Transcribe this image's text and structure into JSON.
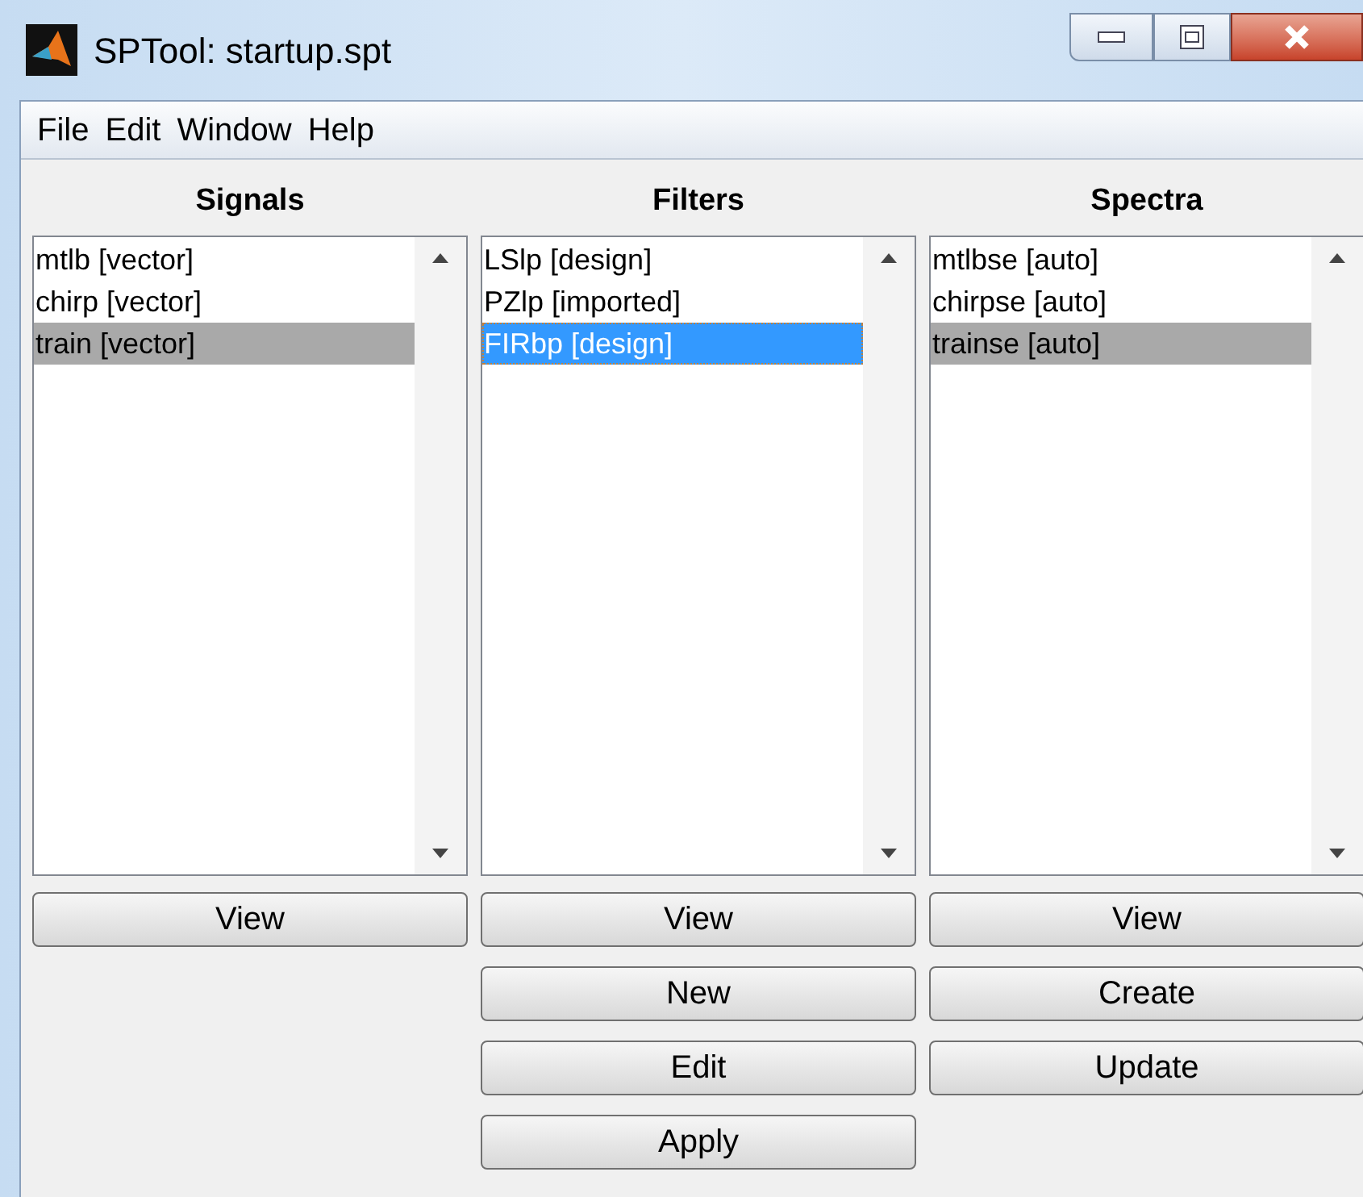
{
  "window": {
    "title": "SPTool: startup.spt"
  },
  "menu": [
    "File",
    "Edit",
    "Window",
    "Help"
  ],
  "columns": [
    {
      "title": "Signals",
      "focused": false,
      "items": [
        {
          "label": "mtlb [vector]",
          "selected": false
        },
        {
          "label": "chirp [vector]",
          "selected": false
        },
        {
          "label": "train [vector]",
          "selected": true
        }
      ],
      "buttons": [
        "View"
      ]
    },
    {
      "title": "Filters",
      "focused": true,
      "items": [
        {
          "label": "LSlp [design]",
          "selected": false
        },
        {
          "label": "PZlp [imported]",
          "selected": false
        },
        {
          "label": "FIRbp [design]",
          "selected": true
        }
      ],
      "buttons": [
        "View",
        "New",
        "Edit",
        "Apply"
      ]
    },
    {
      "title": "Spectra",
      "focused": false,
      "items": [
        {
          "label": "mtlbse [auto]",
          "selected": false
        },
        {
          "label": "chirpse [auto]",
          "selected": false
        },
        {
          "label": "trainse [auto]",
          "selected": true
        }
      ],
      "buttons": [
        "View",
        "Create",
        "Update"
      ]
    }
  ]
}
